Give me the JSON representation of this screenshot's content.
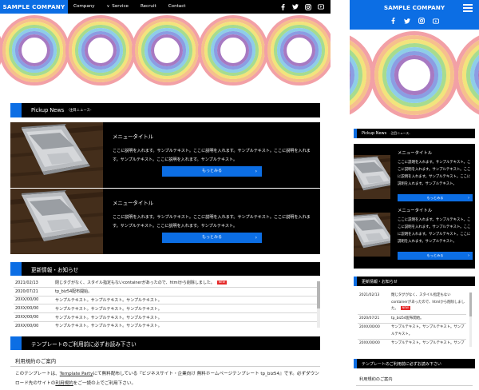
{
  "site": {
    "logo": "SAMPLE COMPANY",
    "nav": [
      "Company",
      "Service",
      "Recruit",
      "Contact"
    ],
    "social_icons": [
      "facebook-icon",
      "twitter-icon",
      "instagram-icon",
      "youtube-icon"
    ]
  },
  "hero": {
    "rings_colors": [
      "#f2a0a6",
      "#f6c08d",
      "#f2e47c",
      "#a7dc8f",
      "#8ecde8",
      "#8b9de3",
      "#a779c2"
    ]
  },
  "pickup": {
    "title": "Pickup News",
    "subtitle": "-注目ニュース-",
    "cards": [
      {
        "title": "メニュータイトル",
        "desc": "ここに説明を入れます。サンプルテキスト。ここに説明を入れます。サンプルテキスト。ここに説明を入れます。サンプルテキスト。ここに説明を入れます。サンプルテキスト。",
        "button": "もっとみる"
      },
      {
        "title": "メニュータイトル",
        "desc": "ここに説明を入れます。サンプルテキスト。ここに説明を入れます。サンプルテキスト。ここに説明を入れます。サンプルテキスト。ここに説明を入れます。サンプルテキスト。",
        "button": "もっとみる"
      }
    ]
  },
  "updates": {
    "title": "更新情報・お知らせ",
    "items": [
      {
        "date": "2021/02/13",
        "text": "閉じタグがなく、スタイル指定もないcontainerがあったので、htmlから削除しました。",
        "badge": "NEW"
      },
      {
        "date": "2020/07/21",
        "text": "tp_biz54配布開始。",
        "badge": ""
      },
      {
        "date": "20XX/00/00",
        "text": "サンプルテキスト。サンプルテキスト。サンプルテキスト。",
        "badge": ""
      },
      {
        "date": "20XX/00/00",
        "text": "サンプルテキスト。サンプルテキスト。サンプルテキスト。",
        "badge": ""
      },
      {
        "date": "20XX/00/00",
        "text": "サンプルテキスト。サンプルテキスト。サンプルテキスト。",
        "badge": ""
      },
      {
        "date": "20XX/00/00",
        "text": "サンプルテキスト。サンプルテキスト。サンプルテキスト。",
        "badge": ""
      }
    ]
  },
  "terms": {
    "title": "テンプレートのご利用前に必ずお読み下さい",
    "heading": "利用規約のご案内",
    "body_pre": "このテンプレートは、",
    "body_link": "Template Party",
    "body_mid": "にて無料配布している『ビジネスサイト・企業向け 無料ホームページテンプレート tp_biz54』です。必ずダウンロード先のサイトの",
    "body_link2": "利用規約",
    "body_post": "をご一読の上でご利用下さい。"
  },
  "mobile": {
    "updates": [
      {
        "date": "2021/02/13",
        "text": "閉じタグがなく、スタイル指定もないcontainerがあったので、htmlから削除しました。",
        "badge": "NEW"
      },
      {
        "date": "2020/07/21",
        "text": "tp_biz54配布開始。",
        "badge": ""
      },
      {
        "date": "20XX/00/00",
        "text": "サンプルテキスト。サンプルテキスト。サンプルテキスト。",
        "badge": ""
      },
      {
        "date": "20XX/00/00",
        "text": "サンプルテキスト。サンプルテキスト。サンプルテキスト。",
        "badge": ""
      }
    ]
  }
}
